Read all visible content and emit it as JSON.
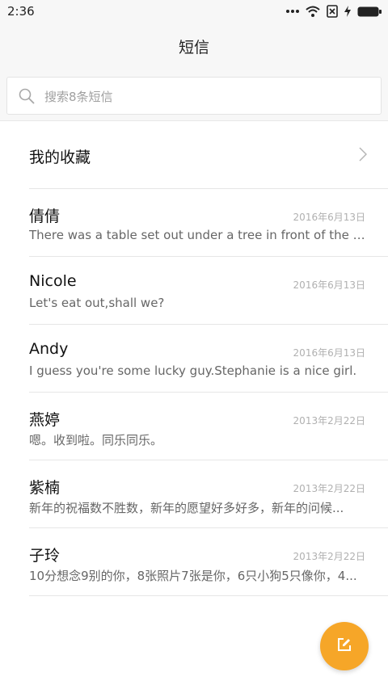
{
  "status_bar": {
    "time": "2:36",
    "icons": [
      "more-dots-icon",
      "wifi-icon",
      "no-sim-icon",
      "charging-bolt-icon",
      "battery-icon"
    ]
  },
  "header": {
    "title": "短信"
  },
  "search": {
    "placeholder": "搜索8条短信",
    "icon": "search-icon"
  },
  "favorites": {
    "label": "我的收藏",
    "icon": "chevron-right-icon"
  },
  "messages": [
    {
      "name": "倩倩",
      "date": "2016年6月13日",
      "preview": "There was a table set out under a tree in front of the ho..."
    },
    {
      "name": "Nicole",
      "date": "2016年6月13日",
      "preview": "Let's eat out,shall we?"
    },
    {
      "name": "Andy",
      "date": "2016年6月13日",
      "preview": "I guess you're some lucky guy.Stephanie is a nice girl."
    },
    {
      "name": "燕婷",
      "date": "2013年2月22日",
      "preview": "嗯。收到啦。同乐同乐。"
    },
    {
      "name": "紫楠",
      "date": "2013年2月22日",
      "preview": "新年的祝福数不胜数，新年的愿望好多好多，新年的问候..."
    },
    {
      "name": "子玲",
      "date": "2013年2月22日",
      "preview": "10分想念9别的你，8张照片7张是你，6只小狗5只像你，4..."
    }
  ],
  "compose": {
    "icon": "compose-icon"
  },
  "colors": {
    "accent": "#f6a628",
    "background": "#f7f7f7",
    "date": "#b0b0b0",
    "preview": "#666666"
  }
}
